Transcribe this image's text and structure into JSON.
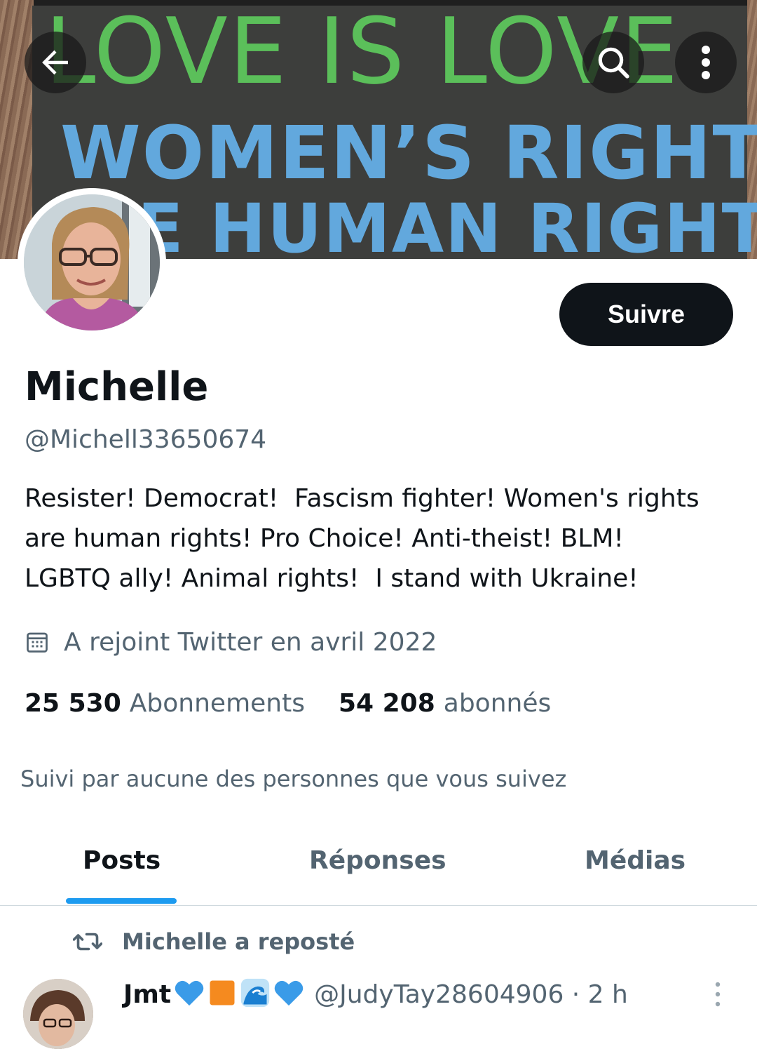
{
  "banner": {
    "line1": "LOVE IS LOVE",
    "line2": "WOMEN’S RIGHTS",
    "line3": "E HUMAN RIGHTS"
  },
  "toolbar": {
    "back_icon": "arrow-left-icon",
    "search_icon": "search-icon",
    "more_icon": "more-vertical-icon"
  },
  "profile": {
    "follow_label": "Suivre",
    "name": "Michelle",
    "handle": "@Michell33650674",
    "bio": "Resister! Democrat!  Fascism fighter! Women's rights\nare human rights! Pro Choice! Anti-theist! BLM!\nLGBTQ ally! Animal rights!  I stand with Ukraine!",
    "joined": "A rejoint Twitter en avril 2022",
    "following_count": "25 530",
    "following_label": "Abonnements",
    "followers_count": "54 208",
    "followers_label": "abonnés",
    "followed_by": "Suivi par aucune des personnes que vous suivez"
  },
  "tabs": {
    "posts": "Posts",
    "replies": "Réponses",
    "media": "Médias"
  },
  "feed": {
    "repost_label": "Michelle a reposté",
    "post_name": "Jmt",
    "post_handle": "@JudyTay28604906 · 2 h"
  },
  "colors": {
    "accent": "#1d9bf0",
    "text": "#0f1419",
    "secondary": "#536471"
  }
}
